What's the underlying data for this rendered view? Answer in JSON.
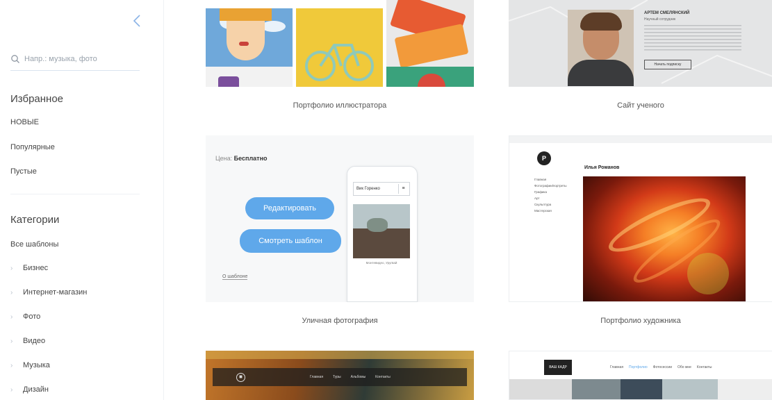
{
  "sidebar": {
    "search_placeholder": "Напр.: музыка, фото",
    "favorites_title": "Избранное",
    "favorites": [
      "НОВЫЕ",
      "Популярные",
      "Пустые"
    ],
    "categories_title": "Категории",
    "all_templates": "Все шаблоны",
    "categories": [
      "Бизнес",
      "Интернет-магазин",
      "Фото",
      "Видео",
      "Музыка",
      "Дизайн"
    ]
  },
  "templates": [
    {
      "label": "Портфолио иллюстратора"
    },
    {
      "label": "Сайт ученого"
    },
    {
      "label": "Уличная фотография"
    },
    {
      "label": "Портфолио художника"
    }
  ],
  "street_preview": {
    "price_label": "Цена:",
    "price_value": "Бесплатно",
    "edit_button": "Редактировать",
    "view_button": "Смотреть шаблон",
    "about_link": "О шаблоне",
    "phone_name": "Вик Горенко",
    "phone_caption": "Монтевидео, Уругвай"
  },
  "scientist_preview": {
    "name": "АРТЕМ СМЕЛЯНСКИЙ",
    "subtitle": "Научный сотрудник",
    "button": "Начать подписку"
  },
  "artist_preview": {
    "logo": "P",
    "name": "Илья Романов",
    "menu": [
      "Главная",
      "Фотографии/портреты",
      "Графика",
      "Арт",
      "Скульптура",
      "Мастерская"
    ]
  },
  "music_preview": {
    "nav": [
      "Главная",
      "Туры",
      "Альбомы",
      "Контакты"
    ]
  },
  "photo_preview": {
    "logo": "ВАШ КАДР",
    "nav": [
      "Главная",
      "Портфолио",
      "Фотосессии",
      "Обо мне",
      "Контакты"
    ]
  },
  "colors": {
    "accent": "#5fa8ea",
    "sidebar_text": "#444444",
    "divider": "#eef1f4"
  }
}
